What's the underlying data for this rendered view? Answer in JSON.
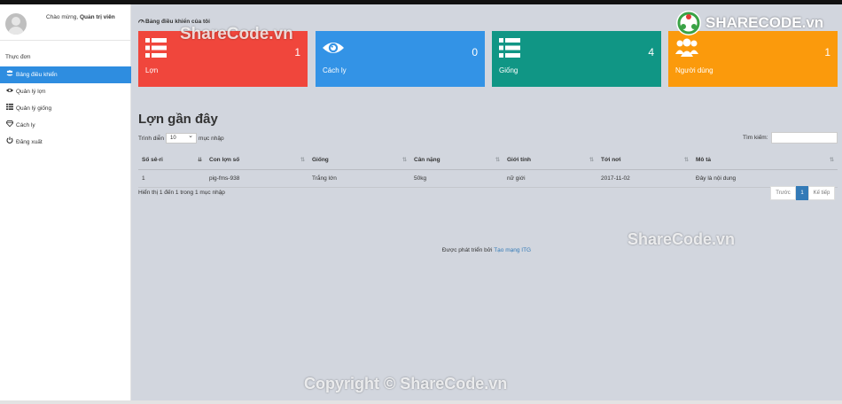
{
  "sidebar": {
    "welcome_prefix": "Chào mừng, ",
    "welcome_user": "Quản trị viên",
    "menu_title": "Thực đơn",
    "items": [
      {
        "label": "Bảng điều khiển",
        "icon": "users-icon",
        "active": true
      },
      {
        "label": "Quản lý lợn",
        "icon": "eye-icon",
        "active": false
      },
      {
        "label": "Quản lý giống",
        "icon": "list-icon",
        "active": false
      },
      {
        "label": "Cách ly",
        "icon": "diamond-icon",
        "active": false
      },
      {
        "label": "Đăng xuất",
        "icon": "power-icon",
        "active": false
      }
    ]
  },
  "header": {
    "title": "Bảng điều khiển của tôi"
  },
  "cards": [
    {
      "label": "Lợn",
      "count": "1",
      "color": "#f0463c",
      "icon": "list-icon"
    },
    {
      "label": "Cách ly",
      "count": "0",
      "color": "#3393e6",
      "icon": "eye-icon"
    },
    {
      "label": "Giống",
      "count": "4",
      "color": "#109685",
      "icon": "list-icon"
    },
    {
      "label": "Người dùng",
      "count": "1",
      "color": "#fb9a0c",
      "icon": "users-icon"
    }
  ],
  "recent": {
    "title": "Lợn gần đây",
    "length_prefix": "Trình diễn",
    "length_value": "10",
    "length_suffix": "mục nhập",
    "search_label": "Tìm kiếm:",
    "search_value": "",
    "columns": [
      "Số sê-ri",
      "Con lợn số",
      "Giống",
      "Cân nặng",
      "Giới tính",
      "Tới nơi",
      "Mô tả"
    ],
    "rows": [
      [
        "1",
        "pig-fms-938",
        "Trắng lớn",
        "50kg",
        "nữ giới",
        "2017-11-02",
        "Đây là nội dung"
      ]
    ],
    "info": "Hiển thị 1 đến 1 trong 1 mục nhập",
    "pager": {
      "prev": "Trước",
      "current": "1",
      "next": "Kế tiếp"
    }
  },
  "footer": {
    "text": "Được phát triển bởi ",
    "link": "Tạo mạng ITG"
  },
  "watermarks": {
    "logo_a": "SHARE",
    "logo_b": "CODE.vn",
    "wm1": "ShareCode.vn",
    "wm2": "ShareCode.vn",
    "wm3": "Copyright © ShareCode.vn"
  }
}
